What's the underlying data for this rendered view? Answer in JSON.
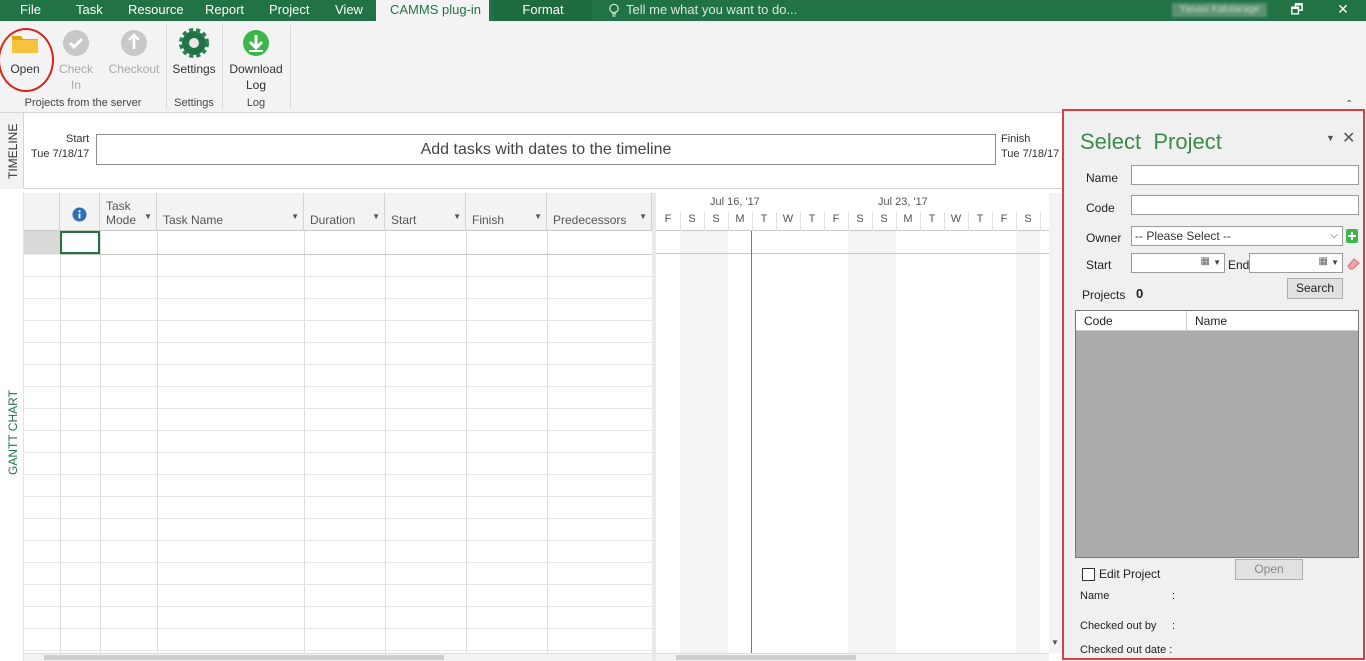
{
  "menu": {
    "tabs": [
      "File",
      "Task",
      "Resource",
      "Report",
      "Project",
      "View",
      "CAMMS plug-in",
      "Format"
    ],
    "active_tab": "CAMMS plug-in",
    "tell_me": "Tell me what you want to do...",
    "user": "Yasasi Kalutarage"
  },
  "ribbon": {
    "open": "Open",
    "check_in_1": "Check",
    "check_in_2": "In",
    "checkout": "Checkout",
    "settings": "Settings",
    "download_1": "Download",
    "download_2": "Log",
    "group_projects": "Projects from the server",
    "group_settings": "Settings",
    "group_log": "Log"
  },
  "timeline": {
    "side_label": "TIMELINE",
    "start_label": "Start",
    "start_date": "Tue 7/18/17",
    "finish_label": "Finish",
    "finish_date": "Tue 7/18/17",
    "placeholder": "Add tasks with dates to the timeline"
  },
  "gantt": {
    "side_label": "GANTT CHART",
    "columns": {
      "task_mode_1": "Task",
      "task_mode_2": "Mode",
      "task_name": "Task Name",
      "duration": "Duration",
      "start": "Start",
      "finish": "Finish",
      "predecessors": "Predecessors"
    },
    "weeks": [
      "Jul 16, '17",
      "Jul 23, '17"
    ],
    "days": [
      "F",
      "S",
      "S",
      "M",
      "T",
      "W",
      "T",
      "F",
      "S",
      "S",
      "M",
      "T",
      "W",
      "T",
      "F",
      "S"
    ]
  },
  "panel": {
    "title": "Select  Project",
    "name_label": "Name",
    "code_label": "Code",
    "owner_label": "Owner",
    "owner_value": "-- Please Select --",
    "start_label": "Start",
    "end_label": "End",
    "projects_label": "Projects",
    "projects_count": "0",
    "search_button": "Search",
    "col_code": "Code",
    "col_name": "Name",
    "edit_project": "Edit Project",
    "open_button": "Open",
    "info_name": "Name",
    "info_checked_out_by": "Checked out by",
    "info_checked_out_date": "Checked out date :",
    "colon": ":"
  },
  "colors": {
    "accent": "#217346",
    "panel_border": "#d94040",
    "highlight": "#d9241c"
  }
}
